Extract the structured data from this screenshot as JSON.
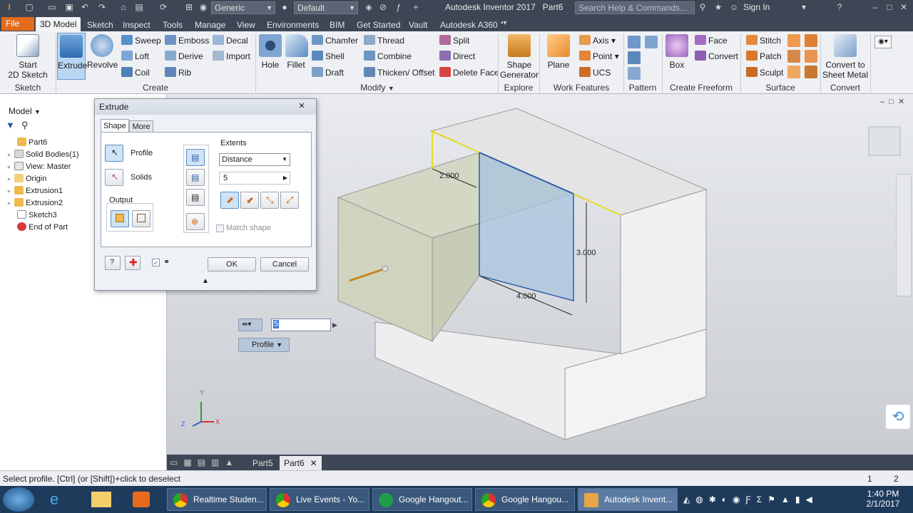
{
  "app": {
    "title": "Autodesk Inventor 2017",
    "document": "Part6",
    "search_placeholder": "Search Help & Commands...",
    "sign_in": "Sign In",
    "material": "Generic",
    "appearance": "Default"
  },
  "tabs": {
    "file": "File",
    "items": [
      "3D Model",
      "Sketch",
      "Inspect",
      "Tools",
      "Manage",
      "View",
      "Environments",
      "BIM",
      "Get Started",
      "Vault",
      "Autodesk A360"
    ]
  },
  "ribbon": {
    "sketch": {
      "title": "Sketch",
      "start": "Start",
      "start2": "2D Sketch"
    },
    "create": {
      "title": "Create",
      "extrude": "Extrude",
      "revolve": "Revolve",
      "sweep": "Sweep",
      "loft": "Loft",
      "coil": "Coil",
      "emboss": "Emboss",
      "derive": "Derive",
      "rib": "Rib",
      "decal": "Decal",
      "import": "Import"
    },
    "modify": {
      "title": "Modify",
      "hole": "Hole",
      "fillet": "Fillet",
      "chamfer": "Chamfer",
      "shell": "Shell",
      "draft": "Draft",
      "thread": "Thread",
      "combine": "Combine",
      "thicken": "Thicken/ Offset",
      "split": "Split",
      "direct": "Direct",
      "delete_face": "Delete Face"
    },
    "explore": {
      "title": "Explore",
      "shape1": "Shape",
      "shape2": "Generator"
    },
    "work": {
      "title": "Work Features",
      "plane": "Plane",
      "axis": "Axis",
      "point": "Point",
      "ucs": "UCS"
    },
    "pattern": {
      "title": "Pattern"
    },
    "freeform": {
      "title": "Create Freeform",
      "box": "Box",
      "face": "Face",
      "convert": "Convert"
    },
    "surface": {
      "title": "Surface",
      "stitch": "Stitch",
      "patch": "Patch",
      "sculpt": "Sculpt"
    },
    "convert": {
      "title": "Convert",
      "c1": "Convert to",
      "c2": "Sheet Metal"
    }
  },
  "browser": {
    "title": "Model",
    "items": [
      {
        "label": "Part6",
        "exp": ""
      },
      {
        "label": "Solid Bodies(1)",
        "exp": "+"
      },
      {
        "label": "View: Master",
        "exp": "+"
      },
      {
        "label": "Origin",
        "exp": "+"
      },
      {
        "label": "Extrusion1",
        "exp": "+"
      },
      {
        "label": "Extrusion2",
        "exp": "+"
      },
      {
        "label": "Sketch3",
        "exp": ""
      },
      {
        "label": "End of Part",
        "exp": ""
      }
    ]
  },
  "dialog": {
    "title": "Extrude",
    "tab_shape": "Shape",
    "tab_more": "More",
    "profile": "Profile",
    "solids": "Solids",
    "output": "Output",
    "extents": "Extents",
    "extent_type": "Distance",
    "distance": "5",
    "match_shape": "Match shape",
    "ok": "OK",
    "cancel": "Cancel"
  },
  "canvas": {
    "dim1": "2.000",
    "dim2": "3.000",
    "dim3": "4.000",
    "mini_value": "5",
    "profile_chip": "Profile",
    "axis_x": "X",
    "axis_y": "Y",
    "axis_z": "Z"
  },
  "doc_tabs": [
    "Part5",
    "Part6"
  ],
  "status": {
    "text": "Select profile. [Ctrl] (or [Shift])+click to deselect",
    "n1": "1",
    "n2": "2"
  },
  "taskbar": {
    "items": [
      "Realtime Studen...",
      "Live Events - Yo...",
      "Google Hangout...",
      "Google Hangou...",
      "Autodesk Invent..."
    ],
    "time": "1:40 PM",
    "date": "2/1/2017"
  },
  "colors": {
    "accent": "#e36b1c",
    "selection": "#f0e020",
    "profile_fill": "#a8c4de",
    "ui_dark": "#3d4654"
  }
}
